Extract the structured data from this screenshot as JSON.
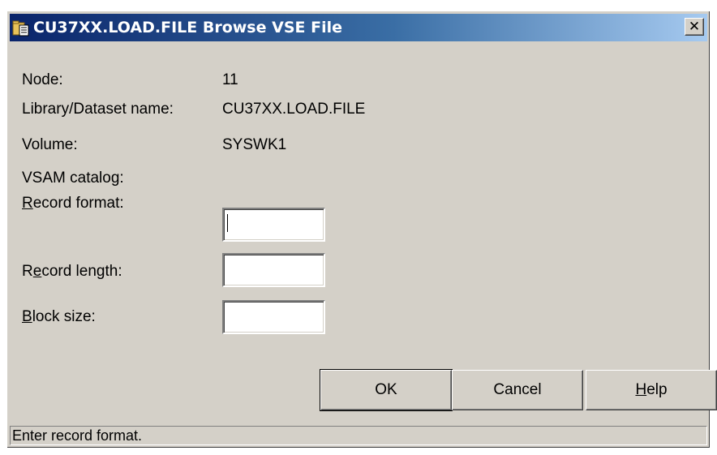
{
  "window": {
    "title": "CU37XX.LOAD.FILE Browse VSE File",
    "close_glyph": "✕"
  },
  "info": {
    "node_label": "Node:",
    "node_value": "11",
    "library_label": "Library/Dataset name:",
    "library_value": "CU37XX.LOAD.FILE",
    "volume_label": "Volume:",
    "volume_value": "SYSWK1",
    "vsam_label": "VSAM catalog:",
    "vsam_value": ""
  },
  "fields": {
    "record_format": {
      "mnemonic": "R",
      "rest": "ecord format:",
      "value": ""
    },
    "record_length": {
      "pre": "R",
      "mnemonic": "e",
      "rest": "cord length:",
      "value": ""
    },
    "block_size": {
      "mnemonic": "B",
      "rest": "lock size:",
      "value": ""
    }
  },
  "buttons": {
    "ok": "OK",
    "cancel": "Cancel",
    "help_mnemonic": "H",
    "help_rest": "elp"
  },
  "status": {
    "text": "Enter record format."
  },
  "icons": {
    "app": "folder-file-icon",
    "close": "close-icon"
  }
}
